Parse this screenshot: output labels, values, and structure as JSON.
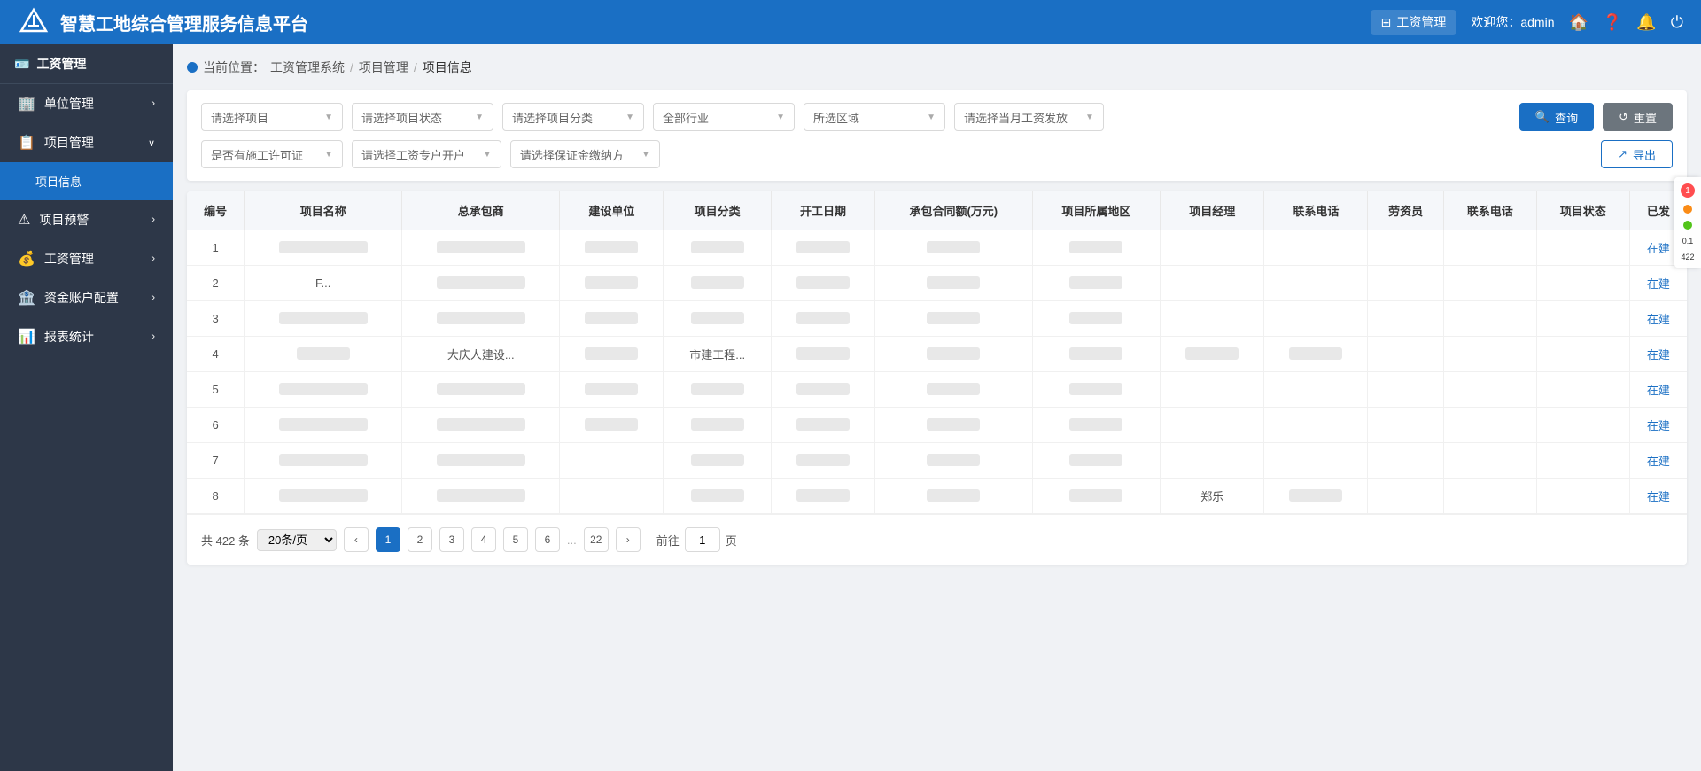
{
  "header": {
    "logo_alt": "智慧工地logo",
    "title": "智慧工地综合管理服务信息平台",
    "module_icon": "grid-icon",
    "module_label": "工资管理",
    "welcome": "欢迎您：admin",
    "icons": [
      "home-icon",
      "help-icon",
      "bell-icon",
      "power-icon"
    ]
  },
  "sidebar": {
    "header_icon": "id-card-icon",
    "header_label": "工资管理",
    "items": [
      {
        "id": "unit-mgmt",
        "label": "单位管理",
        "icon": "building-icon",
        "expanded": false,
        "children": []
      },
      {
        "id": "project-mgmt",
        "label": "项目管理",
        "icon": "project-icon",
        "expanded": true,
        "children": [
          {
            "id": "project-info",
            "label": "项目信息",
            "active": true
          }
        ]
      },
      {
        "id": "project-warning",
        "label": "项目预警",
        "icon": "warning-icon",
        "expanded": false,
        "children": []
      },
      {
        "id": "wage-mgmt",
        "label": "工资管理",
        "icon": "wage-icon",
        "expanded": false,
        "children": []
      },
      {
        "id": "account-config",
        "label": "资金账户配置",
        "icon": "account-icon",
        "expanded": false,
        "children": []
      },
      {
        "id": "report-stats",
        "label": "报表统计",
        "icon": "report-icon",
        "expanded": false,
        "children": []
      }
    ]
  },
  "breadcrumb": {
    "prefix": "当前位置：",
    "items": [
      "工资管理系统",
      "项目管理",
      "项目信息"
    ]
  },
  "filters": {
    "row1": [
      {
        "id": "project-select",
        "placeholder": "请选择项目"
      },
      {
        "id": "project-status",
        "placeholder": "请选择项目状态"
      },
      {
        "id": "project-category",
        "placeholder": "请选择项目分类"
      },
      {
        "id": "industry",
        "placeholder": "全部行业"
      },
      {
        "id": "region",
        "placeholder": "所选区域"
      },
      {
        "id": "wage-date",
        "placeholder": "请选择当月工资发放"
      }
    ],
    "row2": [
      {
        "id": "construction-permit",
        "placeholder": "是否有施工许可证"
      },
      {
        "id": "wage-account",
        "placeholder": "请选择工资专户开户"
      },
      {
        "id": "guarantee-payment",
        "placeholder": "请选择保证金缴纳方"
      }
    ],
    "btn_query": "查询",
    "btn_reset": "重置",
    "btn_export": "导出"
  },
  "table": {
    "columns": [
      "编号",
      "项目名称",
      "总承包商",
      "建设单位",
      "项目分类",
      "开工日期",
      "承包合同额(万元)",
      "项目所属地区",
      "项目经理",
      "联系电话",
      "劳资员",
      "联系电话",
      "项目状态",
      "已发"
    ],
    "rows": [
      {
        "id": 1,
        "status": "在建",
        "data": [
          "blurred-md",
          "blurred-md",
          "blurred-sm",
          "blurred-sm",
          "blurred-sm",
          "blurred-sm",
          "blurred-sm",
          "",
          "",
          "",
          "",
          ""
        ]
      },
      {
        "id": 2,
        "status": "在建",
        "data": [
          "F...",
          "blurred-md",
          "blurred-sm",
          "blurred-sm",
          "blurred-sm",
          "blurred-sm",
          "blurred-sm",
          "",
          "",
          "",
          "",
          ""
        ]
      },
      {
        "id": 3,
        "status": "在建",
        "data": [
          "blurred-md",
          "blurred-md",
          "blurred-sm",
          "blurred-sm",
          "blurred-sm",
          "blurred-sm",
          "blurred-sm",
          "",
          "",
          "",
          "",
          ""
        ]
      },
      {
        "id": 4,
        "status": "在建",
        "data": [
          "blurred-sm",
          "大庆人建设...",
          "blurred-sm",
          "市建工程...",
          "blurred-sm",
          "blurred-sm",
          "blurred-sm",
          "blurred-sm",
          "blurred-sm",
          "",
          "",
          ""
        ]
      },
      {
        "id": 5,
        "status": "在建",
        "data": [
          "blurred-md",
          "blurred-md",
          "blurred-sm",
          "blurred-sm",
          "blurred-sm",
          "blurred-sm",
          "blurred-sm",
          "",
          "",
          "",
          "",
          ""
        ]
      },
      {
        "id": 6,
        "status": "在建",
        "data": [
          "blurred-md",
          "blurred-md",
          "blurred-sm",
          "blurred-sm",
          "blurred-sm",
          "blurred-sm",
          "blurred-sm",
          "",
          "",
          "",
          "",
          ""
        ]
      },
      {
        "id": 7,
        "status": "在建",
        "data": [
          "blurred-md",
          "blurred-md",
          "",
          "blurred-sm",
          "blurred-sm",
          "blurred-sm",
          "blurred-sm",
          "",
          "",
          "",
          "",
          ""
        ]
      },
      {
        "id": 8,
        "status": "在建",
        "data": [
          "blurred-md",
          "blurred-md",
          "",
          "blurred-sm",
          "blurred-sm",
          "blurred-sm",
          "blurred-sm",
          "郑乐",
          "blurred-sm",
          "",
          "",
          ""
        ]
      }
    ]
  },
  "pagination": {
    "total_label": "共 422 条",
    "page_size": "20条/页",
    "pages": [
      1,
      2,
      3,
      4,
      5,
      6
    ],
    "ellipsis": "...",
    "last_page": 22,
    "goto_prefix": "前往",
    "goto_value": "1",
    "goto_suffix": "页",
    "current_page": 1
  },
  "right_panel": {
    "badge_count": "1",
    "value": "0.1",
    "sub_value": "422"
  }
}
